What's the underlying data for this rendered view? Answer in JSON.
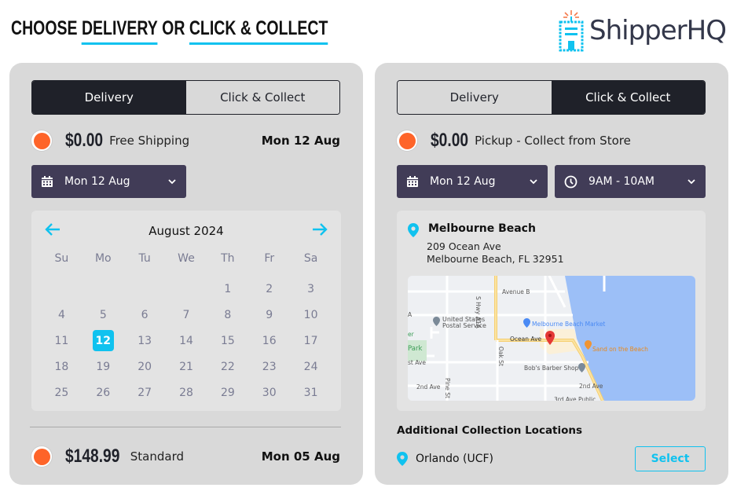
{
  "header": {
    "title_prefix": "CHOOSE",
    "title_delivery": "DELIVERY",
    "title_or": "OR",
    "title_collect": "CLICK & COLLECT",
    "logo_text": "ShipperHQ",
    "accent_color": "#10c2ef"
  },
  "delivery_panel": {
    "tabs": [
      {
        "label": "Delivery",
        "active": true
      },
      {
        "label": "Click & Collect",
        "active": false
      }
    ],
    "option1": {
      "price": "$0.00",
      "service": "Free Shipping",
      "date": "Mon 12 Aug",
      "selected": true
    },
    "date_dropdown": {
      "icon": "calendar-icon",
      "value": "Mon 12 Aug"
    },
    "calendar": {
      "month_label": "August 2024",
      "prev_icon": "arrow-left-icon",
      "next_icon": "arrow-right-icon",
      "weekdays": [
        "Su",
        "Mo",
        "Tu",
        "We",
        "Th",
        "Fr",
        "Sa"
      ],
      "days": [
        "",
        "",
        "",
        "",
        "1",
        "2",
        "3",
        "4",
        "5",
        "6",
        "7",
        "8",
        "9",
        "10",
        "11",
        "12",
        "13",
        "14",
        "15",
        "16",
        "17",
        "18",
        "19",
        "20",
        "21",
        "22",
        "23",
        "24",
        "25",
        "26",
        "27",
        "28",
        "29",
        "30",
        "31"
      ],
      "selected_day": "12"
    },
    "option2": {
      "price": "$148.99",
      "service": "Standard",
      "date": "Mon 05 Aug",
      "selected": true
    }
  },
  "collect_panel": {
    "tabs": [
      {
        "label": "Delivery",
        "active": false
      },
      {
        "label": "Click & Collect",
        "active": true
      }
    ],
    "option": {
      "price": "$0.00",
      "service": "Pickup - Collect from Store",
      "selected": true
    },
    "date_dropdown": {
      "icon": "calendar-icon",
      "value": "Mon 12 Aug"
    },
    "time_dropdown": {
      "icon": "clock-icon",
      "value": "9AM - 10AM"
    },
    "location": {
      "name": "Melbourne Beach",
      "address_line1": "209 Ocean Ave",
      "address_line2": "Melbourne Beach, FL 32951"
    },
    "map_labels": {
      "avenue_b": "Avenue B",
      "hwy": "S Hwy A1A",
      "usps1": "United States",
      "usps2": "Postal Service",
      "market": "Melbourne Beach Market",
      "ocean_ave": "Ocean Ave",
      "sand": "Sand on the Beach",
      "park": "Park",
      "er": "er",
      "first_ave": "st Ave",
      "oak": "Oak St",
      "bobs": "Bob's Barber Shop",
      "second_ave_left": "2nd Ave",
      "pine": "Pine St",
      "second_ave_right": "2nd Ave",
      "third_ave": "3rd Ave Public",
      "a_label": "A"
    },
    "additional_heading": "Additional Collection Locations",
    "additional_locations": [
      {
        "name": "Orlando (UCF)",
        "button": "Select"
      }
    ]
  }
}
